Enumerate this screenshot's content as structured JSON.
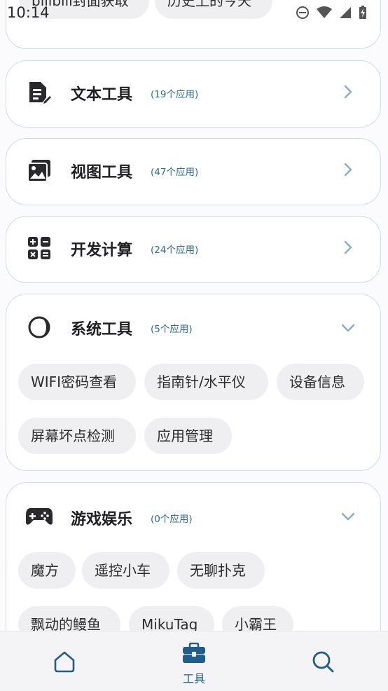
{
  "status_bar": {
    "time": "10:14"
  },
  "top_partial": {
    "chips": [
      "bilibili封面获取",
      "历史上的今天"
    ]
  },
  "categories": [
    {
      "title": "文本工具",
      "count": "(19个应用)",
      "icon": "text-document-icon",
      "expanded": false
    },
    {
      "title": "视图工具",
      "count": "(47个应用)",
      "icon": "image-gallery-icon",
      "expanded": false
    },
    {
      "title": "开发计算",
      "count": "(24个应用)",
      "icon": "calculator-icon",
      "expanded": false
    },
    {
      "title": "系统工具",
      "count": "(5个应用)",
      "icon": "half-moon-icon",
      "expanded": true,
      "apps": [
        "WIFI密码查看",
        "指南针/水平仪",
        "设备信息",
        "屏幕坏点检测",
        "应用管理"
      ]
    },
    {
      "title": "游戏娱乐",
      "count": "(0个应用)",
      "icon": "gamepad-icon",
      "expanded": true,
      "apps": [
        "魔方",
        "遥控小车",
        "无聊扑克",
        "飘动的鳗鱼",
        "MikuTag",
        "小霸王"
      ]
    }
  ],
  "bottom_nav": {
    "items": [
      {
        "icon": "home-icon",
        "label": ""
      },
      {
        "icon": "toolbox-icon",
        "label": "工具",
        "active": true
      },
      {
        "icon": "search-icon",
        "label": ""
      }
    ]
  },
  "colors": {
    "accent": "#1f5e8a",
    "count_text": "#2d6e95",
    "card_border": "#cfdde6",
    "chip_bg": "#efeff1"
  }
}
